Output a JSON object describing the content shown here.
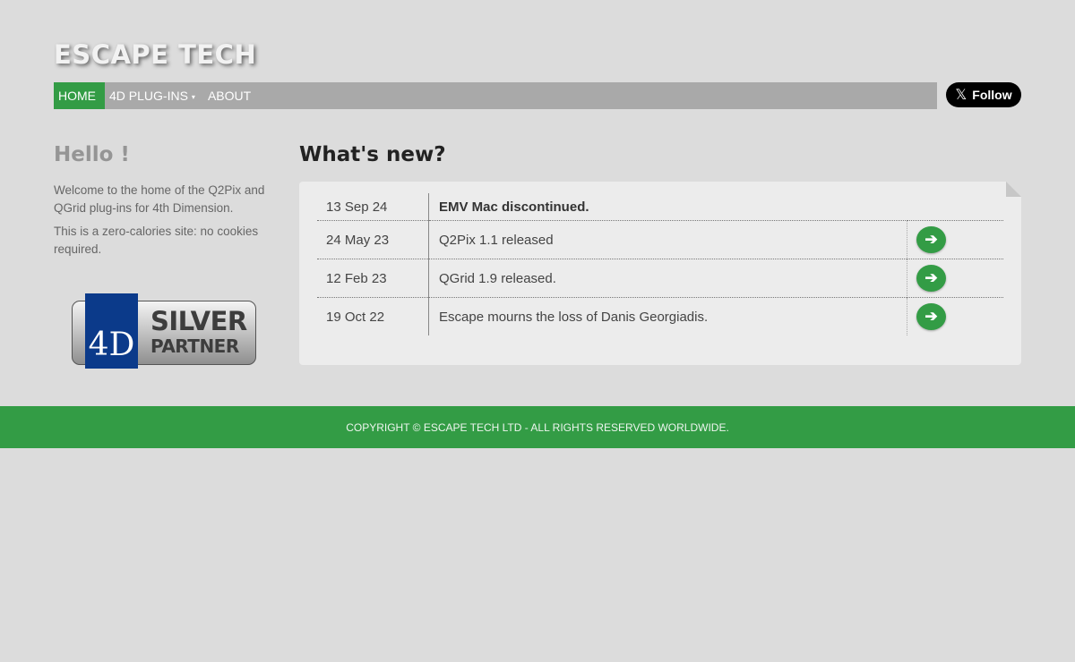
{
  "brand": "ESCAPE TECH",
  "nav": {
    "home": "HOME",
    "plugins": "4D PLUG-INS",
    "about": "ABOUT",
    "plugins_caret": "▾"
  },
  "social": {
    "follow_label": "Follow",
    "logo_glyph": "𝕏"
  },
  "sidebar": {
    "heading": "Hello !",
    "welcome": "Welcome to the home of the Q2Pix and QGrid plug-ins for 4th Dimension.",
    "cookies": "This is a zero-calories site: no cookies required.",
    "badge": {
      "logo": "4D",
      "line1": "SILVER",
      "line2": "PARTNER"
    }
  },
  "news": {
    "heading": "What's new?",
    "items": [
      {
        "date": "13 Sep 24",
        "title": "EMV Mac discontinued.",
        "bold": true,
        "has_link": false
      },
      {
        "date": "24 May 23",
        "title": "Q2Pix 1.1 released",
        "bold": false,
        "has_link": true
      },
      {
        "date": "12 Feb 23",
        "title": "QGrid 1.9 released.",
        "bold": false,
        "has_link": true
      },
      {
        "date": "19 Oct 22",
        "title": "Escape mourns the loss of Danis Georgiadis.",
        "bold": false,
        "has_link": true
      }
    ],
    "arrow_glyph": "➔"
  },
  "footer": {
    "text": "COPYRIGHT © ESCAPE TECH LTD - ALL RIGHTS RESERVED WORLDWIDE."
  },
  "colors": {
    "accent": "#339c45",
    "navbar": "#a9a9a9",
    "background": "#dcdcdc"
  }
}
